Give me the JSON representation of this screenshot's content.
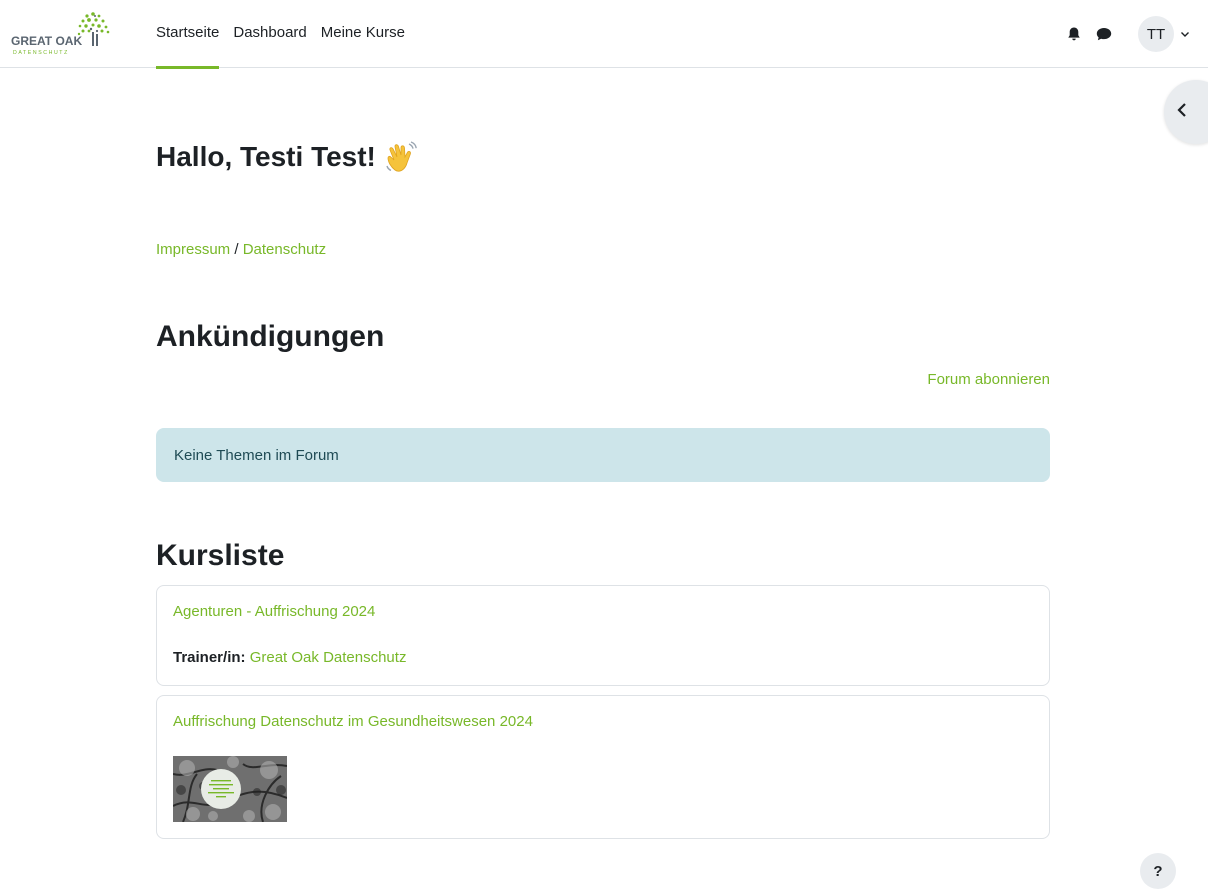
{
  "brand": {
    "name": "GREAT OAK",
    "tagline": "DATENSCHUTZ"
  },
  "nav": {
    "items": [
      {
        "label": "Startseite",
        "active": true
      },
      {
        "label": "Dashboard",
        "active": false
      },
      {
        "label": "Meine Kurse",
        "active": false
      }
    ],
    "icons": {
      "notifications": "bell-icon",
      "messages": "chat-bubble-icon"
    },
    "user_initials": "TT"
  },
  "greeting": {
    "text": "Hallo, Testi Test!",
    "emoji": "waving-hand"
  },
  "links": {
    "impressum": "Impressum",
    "separator": "/",
    "datenschutz": "Datenschutz"
  },
  "announcements": {
    "heading": "Ankündigungen",
    "subscribe_label": "Forum abonnieren",
    "empty_message": "Keine Themen im Forum"
  },
  "course_list": {
    "heading": "Kursliste",
    "courses": [
      {
        "title": "Agenturen - Auffrischung 2024",
        "trainer_label": "Trainer/in:",
        "trainer": "Great Oak Datenschutz"
      },
      {
        "title": "Auffrischung Datenschutz im Gesundheitswesen 2024"
      }
    ]
  },
  "help": {
    "label": "?"
  },
  "colors": {
    "accent": "#78b829",
    "alert_bg": "#cde5ea",
    "alert_text": "#1f4b55"
  }
}
